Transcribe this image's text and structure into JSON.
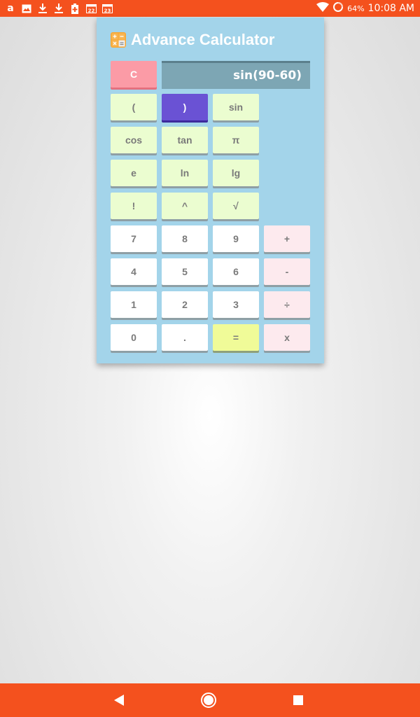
{
  "status_bar": {
    "left_icons": [
      "amazon-icon",
      "image-icon",
      "download-icon",
      "download-icon",
      "battery-saver-icon",
      "calendar-22-icon",
      "calendar-23-icon"
    ],
    "calendar_day_1": "22",
    "calendar_day_2": "23",
    "battery": "64%",
    "time": "10:08 AM"
  },
  "app": {
    "title": "Advance Calculator"
  },
  "display": {
    "expression": "sin(90-60)"
  },
  "buttons": {
    "clear": "C",
    "lparen": "(",
    "rparen": ")",
    "sin": "sin",
    "cos": "cos",
    "tan": "tan",
    "pi": "π",
    "e": "e",
    "ln": "ln",
    "lg": "lg",
    "fact": "!",
    "pow": "^",
    "sqrt": "√",
    "d7": "7",
    "d8": "8",
    "d9": "9",
    "plus": "+",
    "d4": "4",
    "d5": "5",
    "d6": "6",
    "minus": "-",
    "d1": "1",
    "d2": "2",
    "d3": "3",
    "divide": "÷",
    "d0": "0",
    "dot": ".",
    "equals": "=",
    "times": "x"
  },
  "colors": {
    "system_bar": "#f4511e",
    "calculator_bg": "#a3d4ea",
    "function_button": "#ebfdd0",
    "digit_button": "#ffffff",
    "operator_button": "#fdeaee",
    "equals_button": "#f0fb98",
    "active_button": "#6a52d4",
    "clear_button": "#fb9ba6"
  }
}
